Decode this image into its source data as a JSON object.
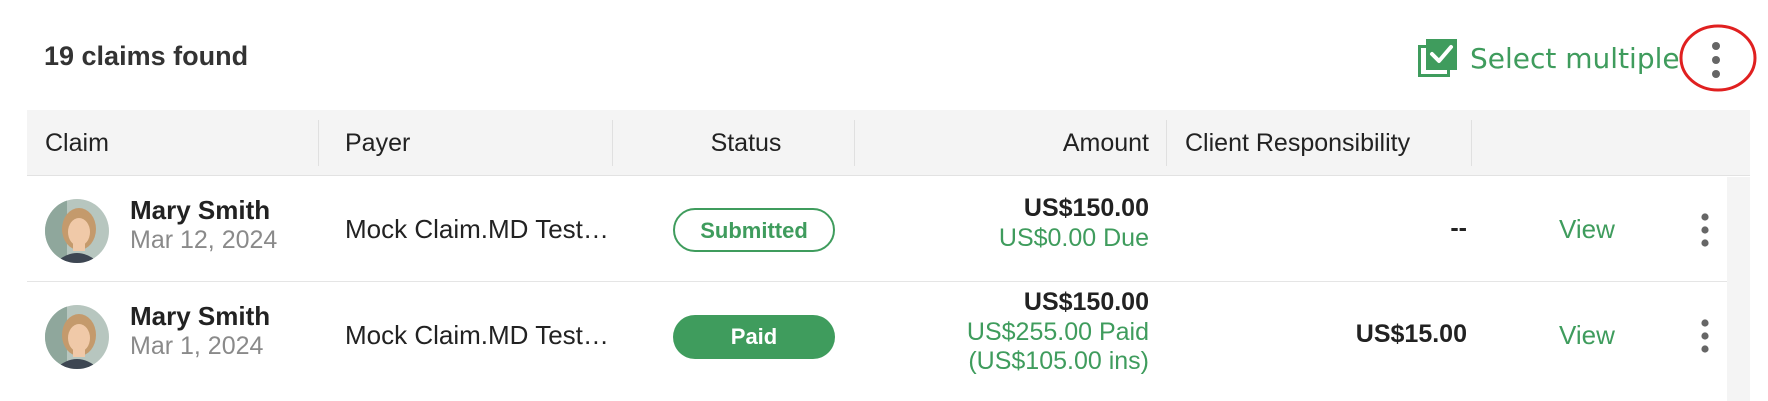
{
  "header": {
    "claims_count": "19 claims found",
    "select_multiple_label": "Select multiple",
    "select_multiple_icon": "checkbox-stack-icon",
    "more_icon": "vertical-dots-icon"
  },
  "table": {
    "columns": [
      "Claim",
      "Payer",
      "Status",
      "Amount",
      "Client Responsibility"
    ],
    "rows": [
      {
        "name": "Mary Smith",
        "date": "Mar 12, 2024",
        "payer": "Mock Claim.MD Test…",
        "status": "Submitted",
        "amount": "US$150.00",
        "amount_line2": "US$0.00 Due",
        "amount_line3": "",
        "client_responsibility": "--",
        "action": "View"
      },
      {
        "name": "Mary Smith",
        "date": "Mar 1, 2024",
        "payer": "Mock Claim.MD Test…",
        "status": "Paid",
        "amount": "US$150.00",
        "amount_line2": "US$255.00 Paid",
        "amount_line3": "(US$105.00 ins)",
        "client_responsibility": "US$15.00",
        "action": "View"
      }
    ]
  },
  "colors": {
    "accent_green": "#3f9c5d",
    "annotation_red": "#e02020",
    "header_bg": "#f4f4f4"
  }
}
